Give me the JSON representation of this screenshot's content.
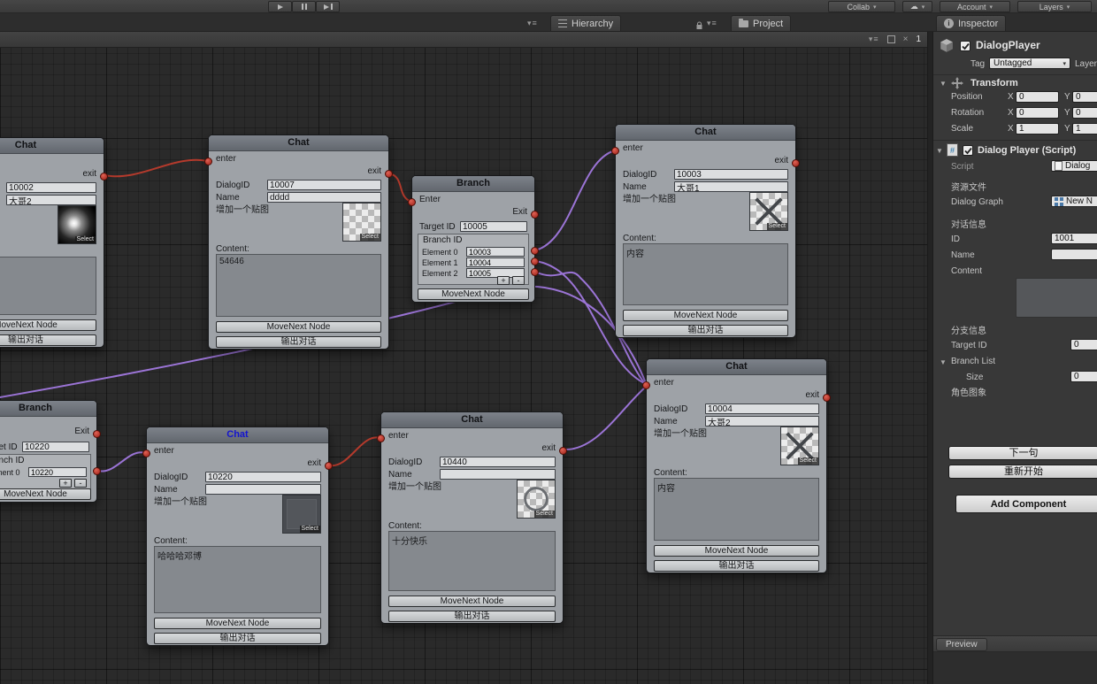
{
  "colors": {
    "wire_red": "#b43a2c",
    "wire_purple": "#9b74d6",
    "port_red": "#b02a1e",
    "node_body": "#9ea2a7",
    "node_header": "#6e737a",
    "blue_node_title": "#1414cf",
    "graph_background": "#2a2a2a",
    "panel_background": "#383838"
  },
  "icons": {
    "pane_menu": "▾≡",
    "close": "×",
    "dropdown": "▾",
    "cloud": "☁",
    "fold": "▼",
    "info_letter": "i"
  },
  "toolbar": {
    "collab": "Collab",
    "account": "Account",
    "layers": "Layers"
  },
  "tabs": {
    "hierarchy": "Hierarchy",
    "project": "Project",
    "inspector": "Inspector",
    "graph_page": "1"
  },
  "graph": {
    "labels": {
      "enter": "enter",
      "exit": "exit",
      "enter_cap": "Enter",
      "exit_cap": "Exit",
      "dialog_id": "DialogID",
      "name": "Name",
      "add_image": "增加一个贴图",
      "content": "Content:",
      "movenext": "MoveNext Node",
      "output": "输出对话",
      "select": "Select",
      "target_id": "Target ID",
      "branch_id": "Branch ID",
      "element0": "Element 0",
      "element1": "Element 1",
      "element2": "Element 2",
      "plus": "+",
      "minus": "-"
    },
    "nodes": {
      "chat_a": {
        "title": "Chat",
        "dialog_id": "10002",
        "name": "大哥2",
        "content": ""
      },
      "chat_b": {
        "title": "Chat",
        "dialog_id": "10007",
        "name": "dddd",
        "content": "54646"
      },
      "branch_c": {
        "title": "Branch",
        "target_id": "10005",
        "elements": [
          "10003",
          "10004",
          "10005"
        ]
      },
      "chat_d": {
        "title": "Chat",
        "dialog_id": "10003",
        "name": "大哥1",
        "content": "内容"
      },
      "chat_e": {
        "title": "Chat",
        "dialog_id": "10004",
        "name": "大哥2",
        "content": "内容"
      },
      "branch_f": {
        "title": "Branch",
        "target_id": "10220",
        "elements": [
          "10220"
        ]
      },
      "chat_g": {
        "title": "Chat",
        "dialog_id": "10220",
        "name": "",
        "content": "哈哈哈邓博"
      },
      "chat_h": {
        "title": "Chat",
        "dialog_id": "10440",
        "name": "",
        "content": "十分快乐"
      }
    }
  },
  "inspector": {
    "tab": "Inspector",
    "header": {
      "name": "DialogPlayer",
      "tag_label": "Tag",
      "tag_value": "Untagged",
      "layer_label": "Layer"
    },
    "transform": {
      "title": "Transform",
      "x_label": "X",
      "y_label": "Y",
      "rows": [
        {
          "label": "Position",
          "x": "0",
          "y": "0"
        },
        {
          "label": "Rotation",
          "x": "0",
          "y": "0"
        },
        {
          "label": "Scale",
          "x": "1",
          "y": "1"
        }
      ]
    },
    "script_component": {
      "title": "Dialog Player (Script)",
      "script_label": "Script",
      "script_value": "Dialog",
      "section_resource": "资源文件",
      "dialog_graph_label": "Dialog Graph",
      "dialog_graph_value": "New N",
      "section_dialog": "对话信息",
      "id_label": "ID",
      "id_value": "1001",
      "name_label": "Name",
      "name_value": "",
      "content_label": "Content",
      "content_value": "",
      "section_branch": "分支信息",
      "target_id_label": "Target ID",
      "target_id_value": "0",
      "branch_list_label": "Branch List",
      "size_label": "Size",
      "size_value": "0",
      "section_avatar": "角色图象",
      "next_button": "下一句",
      "restart_button": "重新开始"
    },
    "add_component": "Add Component",
    "preview": "Preview"
  }
}
